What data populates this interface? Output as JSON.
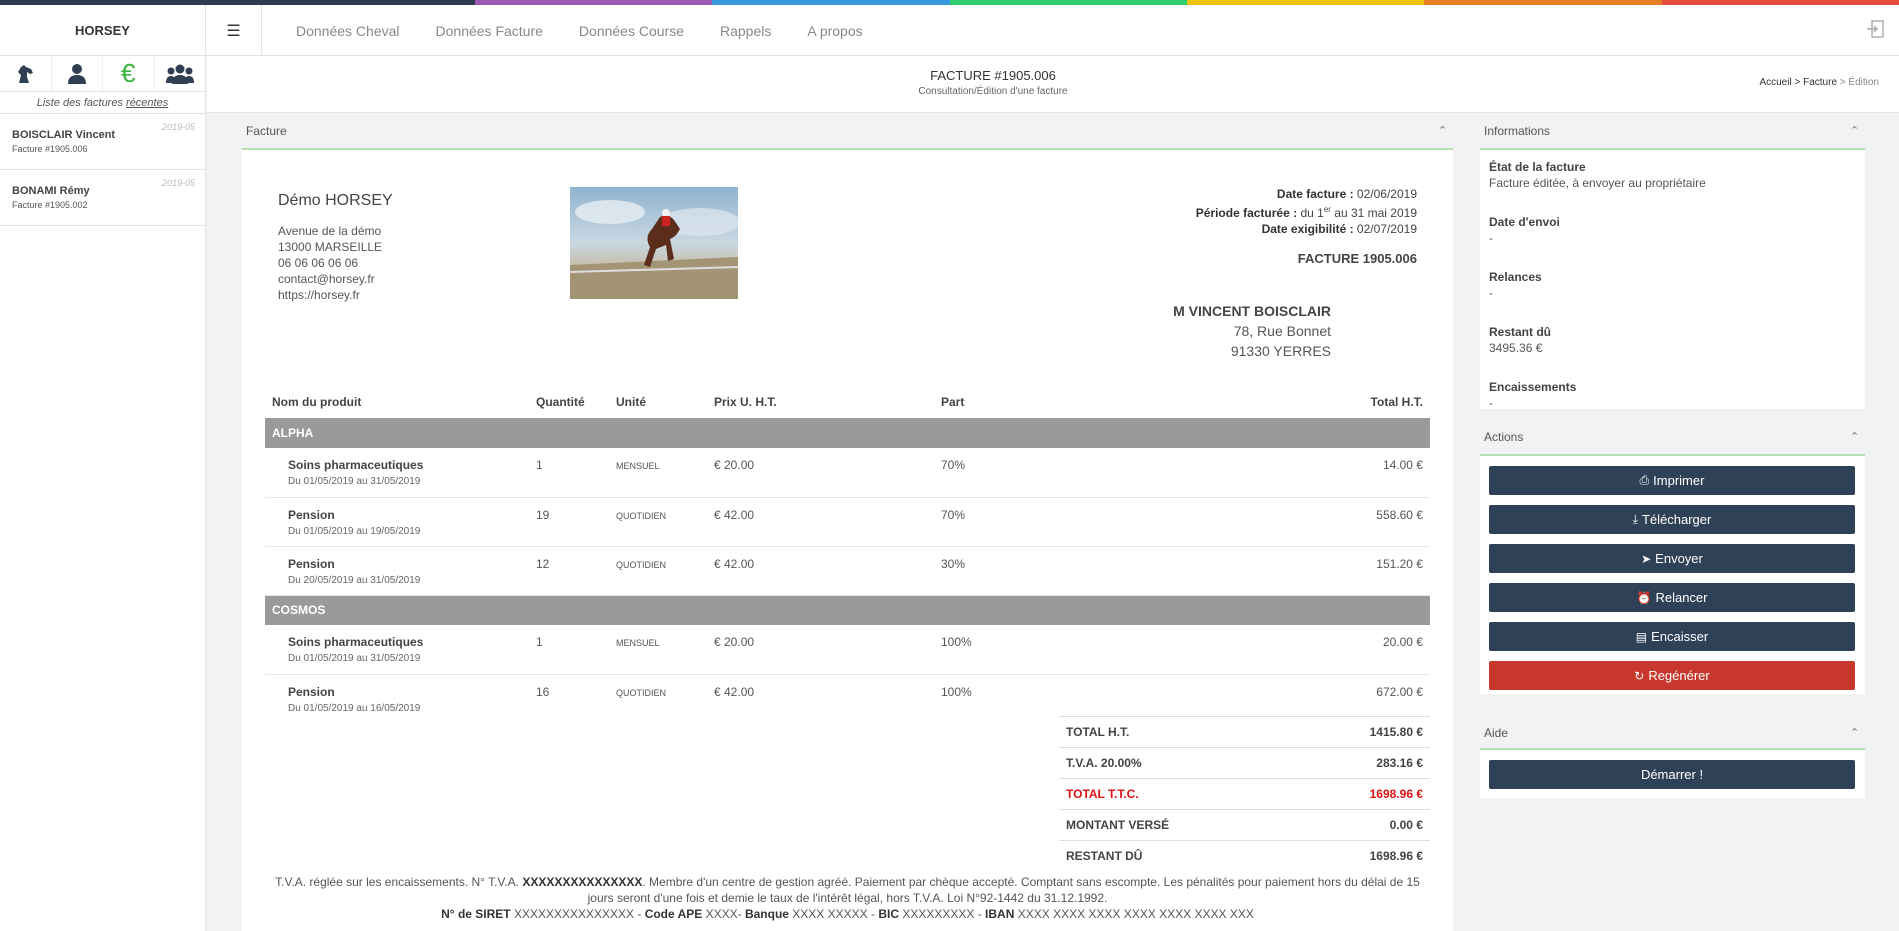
{
  "colors": {
    "accent_green": "#b7e0b0",
    "nav_dark": "#2e4156",
    "danger": "#c8372c",
    "euro_green": "#3cb13c"
  },
  "rainbow": [
    "#2e3b4e",
    "#2e3b4e",
    "#9b59b6",
    "#3498db",
    "#2ecc71",
    "#f1c40f",
    "#e67e22",
    "#e74c3c"
  ],
  "app": {
    "brand": "HORSEY",
    "menu_icon": "hamburger-icon",
    "logout_icon": "logout-icon"
  },
  "topnav": [
    "Données Cheval",
    "Données Facture",
    "Données Course",
    "Rappels",
    "A propos"
  ],
  "sidebar": {
    "icons": [
      "horse-icon",
      "user-icon",
      "euro-icon",
      "group-icon"
    ],
    "euro_symbol": "€",
    "caption_prefix": "Liste des factures ",
    "caption_emph": "récentes",
    "items": [
      {
        "name": "BOISCLAIR Vincent",
        "sub": "Facture #1905.006",
        "date": "2019-05"
      },
      {
        "name": "BONAMI Rémy",
        "sub": "Facture #1905.002",
        "date": "2019-05"
      }
    ]
  },
  "header": {
    "title": "FACTURE #1905.006",
    "subtitle": "Consultation/Édition d'une facture",
    "crumb_1": "Accueil",
    "crumb_2": "Facture",
    "crumb_3": "Édition",
    "sep": ">"
  },
  "invoice_panel": {
    "title": "Facture",
    "company": {
      "name": "Démo HORSEY",
      "lines": [
        "Avenue de la démo",
        "13000 MARSEILLE",
        "06 06 06 06 06",
        "contact@horsey.fr",
        "https://horsey.fr"
      ]
    },
    "dates": {
      "date_label": "Date facture :",
      "date_value": " 02/06/2019",
      "period_label": "Période facturée :",
      "period_pre": " du 1",
      "period_sup": "er",
      "period_post": " au 31 mai 2019",
      "due_label": "Date exigibilité :",
      "due_value": " 02/07/2019"
    },
    "number": "FACTURE 1905.006",
    "client": {
      "name": "M VINCENT BOISCLAIR",
      "lines": [
        "78, Rue Bonnet",
        "91330 YERRES"
      ]
    },
    "columns": [
      "Nom du produit",
      "Quantité",
      "Unité",
      "Prix U. H.T.",
      "Part",
      "Total H.T."
    ],
    "groups": [
      {
        "name": "ALPHA",
        "items": [
          {
            "product": "Soins pharmaceutiques",
            "period": "Du 01/05/2019 au 31/05/2019",
            "qty": "1",
            "unit": "MENSUEL",
            "price": "€ 20.00",
            "part": "70%",
            "total": "14.00 €"
          },
          {
            "product": "Pension",
            "period": "Du 01/05/2019 au 19/05/2019",
            "qty": "19",
            "unit": "QUOTIDIEN",
            "price": "€ 42.00",
            "part": "70%",
            "total": "558.60 €"
          },
          {
            "product": "Pension",
            "period": "Du 20/05/2019 au 31/05/2019",
            "qty": "12",
            "unit": "QUOTIDIEN",
            "price": "€ 42.00",
            "part": "30%",
            "total": "151.20 €"
          }
        ]
      },
      {
        "name": "COSMOS",
        "items": [
          {
            "product": "Soins pharmaceutiques",
            "period": "Du 01/05/2019 au 31/05/2019",
            "qty": "1",
            "unit": "MENSUEL",
            "price": "€ 20.00",
            "part": "100%",
            "total": "20.00 €"
          },
          {
            "product": "Pension",
            "period": "Du 01/05/2019 au 16/05/2019",
            "qty": "16",
            "unit": "QUOTIDIEN",
            "price": "€ 42.00",
            "part": "100%",
            "total": "672.00 €"
          }
        ]
      }
    ],
    "totals": [
      {
        "label": "TOTAL H.T.",
        "value": "1415.80 €",
        "highlight": false
      },
      {
        "label": "T.V.A. 20.00%",
        "value": "283.16 €",
        "highlight": false
      },
      {
        "label": "TOTAL T.T.C.",
        "value": "1698.96 €",
        "highlight": true
      },
      {
        "label": "MONTANT VERSÉ",
        "value": "0.00 €",
        "highlight": false
      },
      {
        "label": "RESTANT DÛ",
        "value": "1698.96 €",
        "highlight": false
      }
    ],
    "footer": {
      "l1_a": "T.V.A. réglée sur les encaissements. N° T.V.A. ",
      "l1_b": "XXXXXXXXXXXXXXX",
      "l1_c": ". Membre d'un centre de gestion agréé. Paiement par chèque accepté. Comptant sans escompte. Les pénalités pour paiement hors du délai de 15 jours seront d'une fois et demie le taux de l'intérêt légal, hors T.V.A. Loi N°92-1442 du 31.12.1992.",
      "siret_label": "N° de SIRET",
      "siret_val": " XXXXXXXXXXXXXXX - ",
      "ape_label": "Code APE",
      "ape_val": " XXXX- ",
      "banque_label": "Banque",
      "banque_val": " XXXX XXXXX - ",
      "bic_label": "BIC",
      "bic_val": " XXXXXXXXX - ",
      "iban_label": "IBAN",
      "iban_val": " XXXX XXXX XXXX XXXX XXXX XXXX XXX"
    }
  },
  "info_panel": {
    "title": "Informations",
    "fields": [
      {
        "label": "État de la facture",
        "value": "Facture éditée, à envoyer au propriétaire"
      },
      {
        "label": "Date d'envoi",
        "value": "-"
      },
      {
        "label": "Relances",
        "value": "-"
      },
      {
        "label": "Restant dû",
        "value": "3495.36 €"
      },
      {
        "label": "Encaissements",
        "value": "-"
      }
    ]
  },
  "actions_panel": {
    "title": "Actions",
    "buttons": [
      {
        "label": "Imprimer",
        "icon": "print-icon",
        "danger": false
      },
      {
        "label": "Télécharger",
        "icon": "download-icon",
        "danger": false
      },
      {
        "label": "Envoyer",
        "icon": "send-icon",
        "danger": false
      },
      {
        "label": "Relancer",
        "icon": "alarm-icon",
        "danger": false
      },
      {
        "label": "Encaisser",
        "icon": "money-icon",
        "danger": false
      },
      {
        "label": "Regénérer",
        "icon": "refresh-icon",
        "danger": true
      }
    ]
  },
  "aide_panel": {
    "title": "Aide",
    "button": "Démarrer !"
  }
}
